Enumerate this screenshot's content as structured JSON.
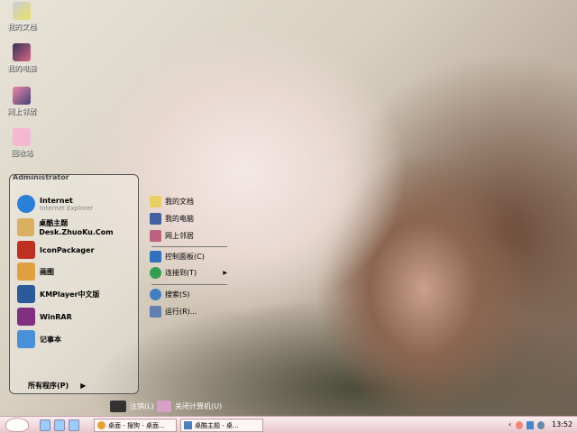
{
  "desktop": {
    "icons": [
      {
        "label": "我的文档"
      },
      {
        "label": "我的电脑"
      },
      {
        "label": "网上邻居"
      },
      {
        "label": "回收站"
      }
    ]
  },
  "start_menu": {
    "user": "Administrator",
    "programs": [
      {
        "label": "Internet",
        "sub": "Internet Explorer",
        "color": "#2a7fd8"
      },
      {
        "label": "桌酷主题Desk.ZhuoKu.Com",
        "color": "#d8b060"
      },
      {
        "label": "IconPackager",
        "color": "#c03020"
      },
      {
        "label": "画图",
        "color": "#e0a040"
      },
      {
        "label": "KMPlayer中文版",
        "color": "#2a5a9a"
      },
      {
        "label": "WinRAR",
        "color": "#803080"
      },
      {
        "label": "记事本",
        "color": "#4a90d8"
      }
    ],
    "all_programs": "所有程序(P)",
    "places": [
      {
        "label": "我的文档",
        "color": "#e8d060"
      },
      {
        "label": "我的电脑",
        "color": "#4060a0"
      },
      {
        "label": "网上邻居",
        "color": "#c06080"
      },
      {
        "label": "控制面板(C)",
        "color": "#3070c0"
      },
      {
        "label": "连接到(T)",
        "color": "#30a050"
      },
      {
        "label": "搜索(S)",
        "color": "#4080c0"
      },
      {
        "label": "运行(R)...",
        "color": "#6080b0"
      }
    ],
    "logoff": "注销(L)",
    "shutdown": "关闭计算机(U)"
  },
  "taskbar": {
    "tasks": [
      {
        "label": "桌面 - 搜狗 - 桌面..."
      },
      {
        "label": "桌酷主题 - 桌..."
      }
    ],
    "clock": "13:52"
  }
}
